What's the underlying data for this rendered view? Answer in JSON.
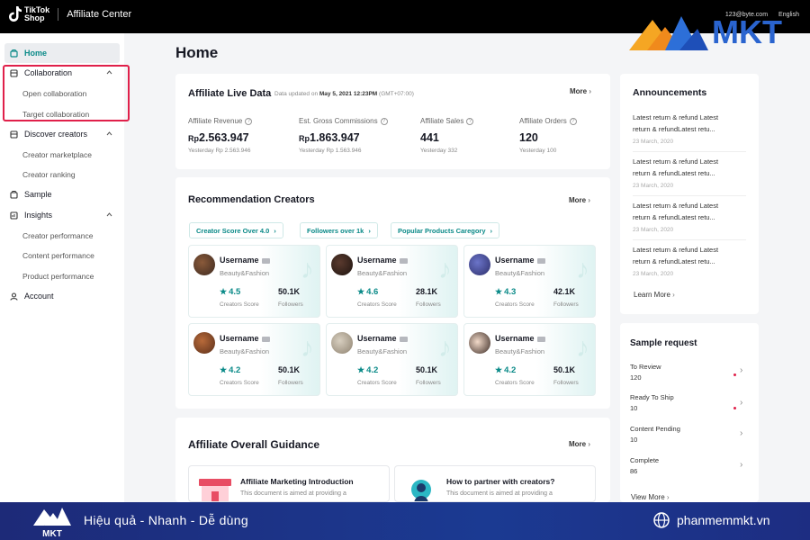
{
  "topbar": {
    "brand_line1": "TikTok",
    "brand_line2": "Shop",
    "app_title": "Affiliate Center",
    "user_email": "123@byte.com",
    "language": "English"
  },
  "watermark": {
    "brand": "MKT"
  },
  "sidebar": {
    "home": "Home",
    "collaboration": "Collaboration",
    "open_collaboration": "Open collaboration",
    "target_collaboration": "Target collaboration",
    "discover_creators": "Discover creators",
    "creator_marketplace": "Creator marketplace",
    "creator_ranking": "Creator ranking",
    "sample": "Sample",
    "insights": "Insights",
    "creator_performance": "Creator performance",
    "content_performance": "Content performance",
    "product_performance": "Product performance",
    "account": "Account"
  },
  "page_title": "Home",
  "live_data": {
    "title": "Affiliate Live Data",
    "updated_prefix": "Data updated on",
    "updated_date": "May 5, 2021 12:23PM",
    "updated_tz": "(GMT+07:00)",
    "more": "More",
    "metrics": [
      {
        "label": "Affiliate Revenue",
        "currency": "Rp",
        "value": "2.563.947",
        "yesterday": "Yesterday Rp 2.563.946"
      },
      {
        "label": "Est. Gross Commissions",
        "currency": "Rp",
        "value": "1.863.947",
        "yesterday": "Yesterday Rp 1.563.946"
      },
      {
        "label": "Affiliate Sales",
        "currency": "",
        "value": "441",
        "yesterday": "Yesterday 332"
      },
      {
        "label": "Affiliate Orders",
        "currency": "",
        "value": "120",
        "yesterday": "Yesterday 100"
      }
    ]
  },
  "recommendation": {
    "title": "Recommendation Creators",
    "more": "More",
    "filters": [
      "Creator Score Over 4.0",
      "Followers over 1k",
      "Popular Products Caregory"
    ],
    "score_label": "Creators Score",
    "followers_label": "Followers",
    "creators": [
      {
        "name": "Username",
        "category": "Beauty&Fashion",
        "score": "4.5",
        "followers": "50.1K"
      },
      {
        "name": "Username",
        "category": "Beauty&Fashion",
        "score": "4.6",
        "followers": "28.1K"
      },
      {
        "name": "Username",
        "category": "Beauty&Fashion",
        "score": "4.3",
        "followers": "42.1K"
      },
      {
        "name": "Username",
        "category": "Beauty&Fashion",
        "score": "4.2",
        "followers": "50.1K"
      },
      {
        "name": "Username",
        "category": "Beauty&Fashion",
        "score": "4.2",
        "followers": "50.1K"
      },
      {
        "name": "Username",
        "category": "Beauty&Fashion",
        "score": "4.2",
        "followers": "50.1K"
      }
    ]
  },
  "guidance": {
    "title": "Affiliate Overall Guidance",
    "more": "More",
    "items": [
      {
        "title": "Affiliate Marketing Introduction",
        "desc": "This document is aimed at providing a"
      },
      {
        "title": "How to partner with creators?",
        "desc": "This document is aimed at providing a"
      }
    ]
  },
  "announcements": {
    "title": "Announcements",
    "items": [
      {
        "line1": "Latest return & refund Latest",
        "line2": "return & refundLatest retu...",
        "date": "23 March, 2020"
      },
      {
        "line1": "Latest return & refund Latest",
        "line2": "return & refundLatest retu...",
        "date": "23 March, 2020"
      },
      {
        "line1": "Latest return & refund Latest",
        "line2": "return & refundLatest retu...",
        "date": "23 March, 2020"
      },
      {
        "line1": "Latest return & refund Latest",
        "line2": "return & refundLatest retu...",
        "date": "23 March, 2020"
      }
    ],
    "learn_more": "Learn More"
  },
  "sample_request": {
    "title": "Sample request",
    "items": [
      {
        "label": "To Review",
        "value": "120"
      },
      {
        "label": "Ready To Ship",
        "value": "10"
      },
      {
        "label": "Content Pending",
        "value": "10"
      },
      {
        "label": "Complete",
        "value": "86"
      }
    ],
    "view_more": "View More"
  },
  "banner": {
    "slogan": "Hiệu quả - Nhanh - Dễ dùng",
    "website": "phanmemmkt.vn",
    "logo_text": "MKT"
  },
  "colors": {
    "accent": "#0a8a88",
    "highlight": "#e0204a",
    "banner": "#1b3a92"
  }
}
